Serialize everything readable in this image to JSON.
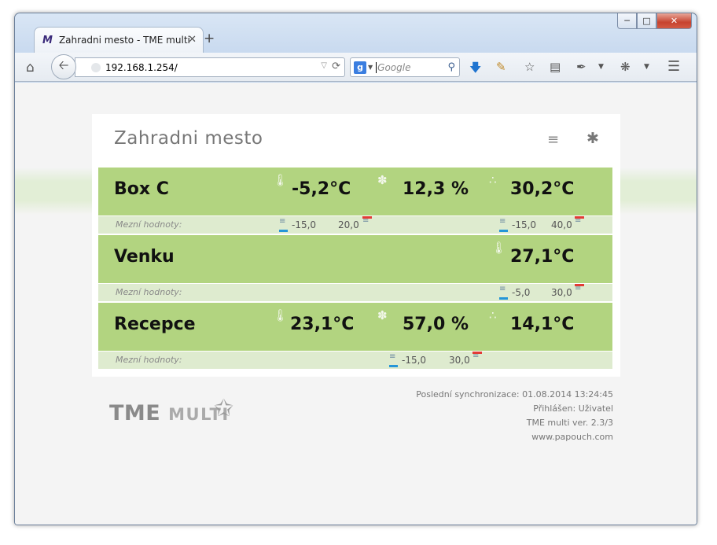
{
  "browser": {
    "tab_title": "Zahradni mesto - TME multi",
    "tab_favicon": "M",
    "url": "192.168.1.254/",
    "search_placeholder": "Google",
    "icons": [
      "home-icon",
      "back-arrow-icon",
      "reload-icon",
      "google-search-icon",
      "download-arrow-icon",
      "broom-icon",
      "bookmark-star-icon",
      "clipboard-icon",
      "pipette-icon",
      "bug-icon",
      "hamburger-menu-icon"
    ]
  },
  "panel": {
    "title": "Zahradni mesto",
    "menu_icon": "≡",
    "gear_icon": "✱"
  },
  "limits_label": "Mezní hodnoty:",
  "rows": [
    {
      "name": "Box C",
      "temp": "-5,2°C",
      "humidity": "12,3 %",
      "dew": "30,2°C",
      "limit1_low": "-15,0",
      "limit1_high": "20,0",
      "limit3_low": "-15,0",
      "limit3_high": "40,0"
    },
    {
      "name": "Venku",
      "temp": "27,1°C",
      "limit_low": "-5,0",
      "limit_high": "30,0"
    },
    {
      "name": "Recepce",
      "temp": "23,1°C",
      "humidity": "57,0 %",
      "dew": "14,1°C",
      "limit2_low": "-15,0",
      "limit2_high": "30,0"
    }
  ],
  "footer": {
    "sync": "Poslední synchronizace: 01.08.2014 13:24:45",
    "user": "Přihlášen: Uživatel",
    "version": "TME multi ver. 2.3/3",
    "website": "www.papouch.com"
  },
  "logo": {
    "main": "TME",
    "sub": "MULTI"
  },
  "colors": {
    "row_bg": "#b2d480",
    "sub_bg": "#deebcf",
    "limit_low": "#2596d8",
    "limit_high": "#e23b36"
  }
}
